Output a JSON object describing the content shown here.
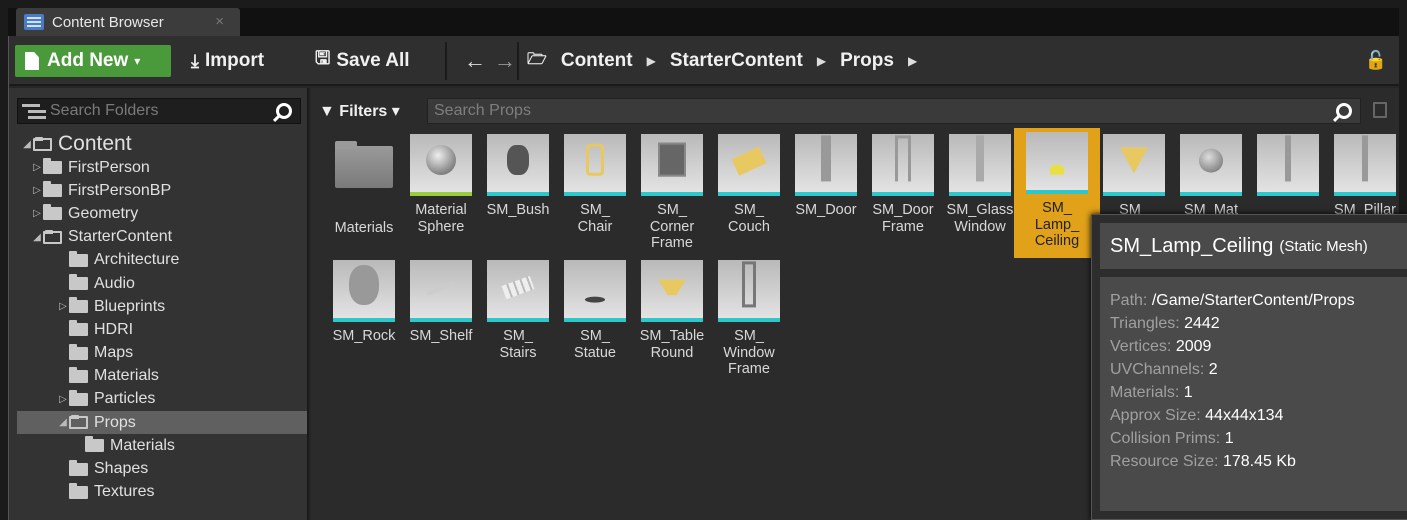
{
  "tab": {
    "title": "Content Browser",
    "close": "×"
  },
  "toolbar": {
    "add_new": "Add New",
    "import": "Import",
    "save_all": "Save All",
    "breadcrumbs": [
      "Content",
      "StarterContent",
      "Props"
    ]
  },
  "folders": {
    "search_placeholder": "Search Folders",
    "tree": [
      {
        "label": "Content",
        "level": 0,
        "expander": "◢",
        "open": true
      },
      {
        "label": "FirstPerson",
        "level": 1,
        "expander": "▷"
      },
      {
        "label": "FirstPersonBP",
        "level": 1,
        "expander": "▷"
      },
      {
        "label": "Geometry",
        "level": 1,
        "expander": "▷"
      },
      {
        "label": "StarterContent",
        "level": 1,
        "expander": "◢",
        "open": true
      },
      {
        "label": "Architecture",
        "level": 2,
        "expander": ""
      },
      {
        "label": "Audio",
        "level": 2,
        "expander": ""
      },
      {
        "label": "Blueprints",
        "level": 2,
        "expander": "▷"
      },
      {
        "label": "HDRI",
        "level": 2,
        "expander": ""
      },
      {
        "label": "Maps",
        "level": 2,
        "expander": ""
      },
      {
        "label": "Materials",
        "level": 2,
        "expander": ""
      },
      {
        "label": "Particles",
        "level": 2,
        "expander": "▷"
      },
      {
        "label": "Props",
        "level": 2,
        "expander": "◢",
        "open": true,
        "selected": true
      },
      {
        "label": "Materials",
        "level": 3,
        "expander": ""
      },
      {
        "label": "Shapes",
        "level": 2,
        "expander": ""
      },
      {
        "label": "Textures",
        "level": 2,
        "expander": ""
      }
    ]
  },
  "assets": {
    "filters_label": "Filters",
    "search_placeholder": "Search Props",
    "row1": [
      {
        "label": "Materials",
        "kind": "folder"
      },
      {
        "label": "Material\nSphere",
        "kind": "mat"
      },
      {
        "label": "SM_Bush",
        "kind": "mesh"
      },
      {
        "label": "SM_\nChair",
        "kind": "mesh"
      },
      {
        "label": "SM_\nCorner\nFrame",
        "kind": "mesh"
      },
      {
        "label": "SM_\nCouch",
        "kind": "mesh"
      },
      {
        "label": "SM_Door",
        "kind": "mesh"
      },
      {
        "label": "SM_Door\nFrame",
        "kind": "mesh"
      },
      {
        "label": "SM_Glass\nWindow",
        "kind": "mesh"
      },
      {
        "label": "SM_\nLamp_\nCeiling",
        "kind": "mesh",
        "selected": true
      },
      {
        "label": "SM_",
        "kind": "mesh"
      },
      {
        "label": "SM_Mat",
        "kind": "mesh"
      },
      {
        "label": "",
        "kind": "mesh"
      },
      {
        "label": "SM_Pillar",
        "kind": "mesh"
      }
    ],
    "row2": [
      {
        "label": "SM_Rock",
        "kind": "mesh"
      },
      {
        "label": "SM_Shelf",
        "kind": "mesh"
      },
      {
        "label": "SM_\nStairs",
        "kind": "mesh"
      },
      {
        "label": "SM_\nStatue",
        "kind": "mesh"
      },
      {
        "label": "SM_Table\nRound",
        "kind": "mesh"
      },
      {
        "label": "SM_\nWindow\nFrame",
        "kind": "mesh"
      }
    ]
  },
  "tooltip": {
    "name": "SM_Lamp_Ceiling",
    "type": "(Static Mesh)",
    "rows": [
      {
        "key": "Path:",
        "value": "/Game/StarterContent/Props"
      },
      {
        "key": "Triangles:",
        "value": "2442"
      },
      {
        "key": "Vertices:",
        "value": "2009"
      },
      {
        "key": "UVChannels:",
        "value": "2"
      },
      {
        "key": "Materials:",
        "value": "1"
      },
      {
        "key": "Approx Size:",
        "value": "44x44x134"
      },
      {
        "key": "Collision Prims:",
        "value": "1"
      },
      {
        "key": "Resource Size:",
        "value": "178.45 Kb"
      }
    ]
  },
  "colors": {
    "accent_green": "#4a9a3c",
    "selection_orange": "#e1a119",
    "mesh_stripe": "#2fc7c9",
    "material_stripe": "#9acc3f"
  }
}
